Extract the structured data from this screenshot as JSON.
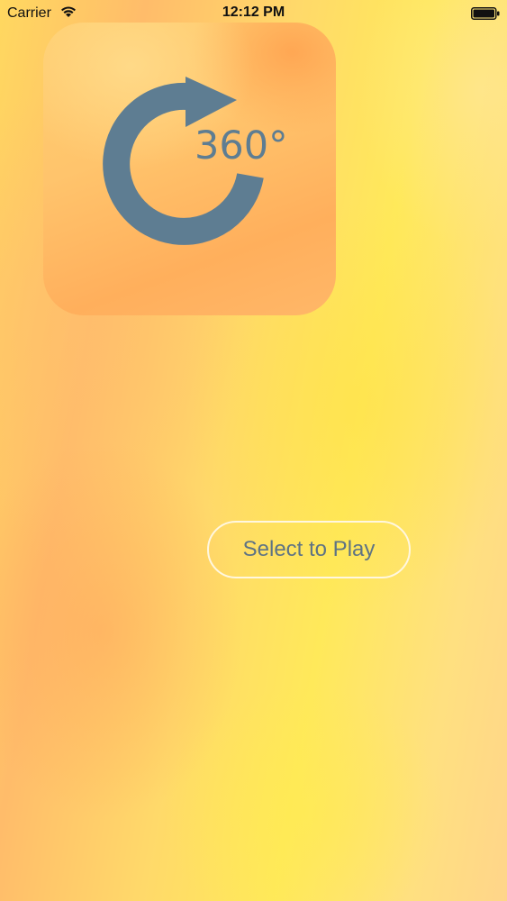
{
  "status_bar": {
    "carrier": "Carrier",
    "time": "12:12 PM",
    "wifi_icon": "wifi-icon",
    "battery_icon": "battery-icon"
  },
  "app_icon": {
    "label": "360°",
    "icon": "rotate-360-icon",
    "symbol_color": "#5e7d92"
  },
  "play_button": {
    "label": "Select to Play"
  },
  "colors": {
    "background_primary": "#ffe95a",
    "background_secondary": "#ffbc6a",
    "button_border": "#fff7e0",
    "button_text": "#5e7384"
  }
}
